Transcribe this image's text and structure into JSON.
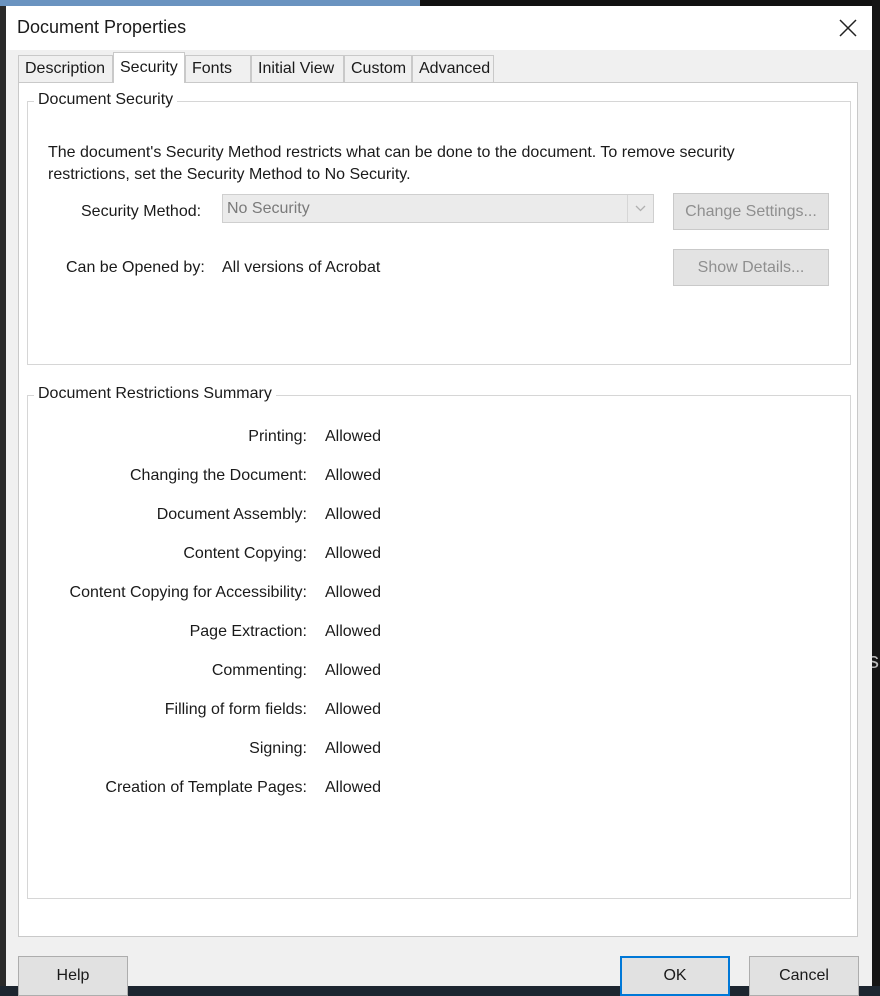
{
  "window": {
    "title": "Document Properties"
  },
  "tabs": [
    {
      "label": "Description",
      "active": false
    },
    {
      "label": "Security",
      "active": true
    },
    {
      "label": "Fonts",
      "active": false
    },
    {
      "label": "Initial View",
      "active": false
    },
    {
      "label": "Custom",
      "active": false
    },
    {
      "label": "Advanced",
      "active": false
    }
  ],
  "document_security": {
    "group_title": "Document Security",
    "description": "The document's Security Method restricts what can be done to the document. To remove security restrictions, set the Security Method to No Security.",
    "method_label": "Security Method:",
    "method_value": "No Security",
    "change_settings_label": "Change Settings...",
    "opened_by_label": "Can be Opened by:",
    "opened_by_value": "All versions of Acrobat",
    "show_details_label": "Show Details..."
  },
  "restrictions": {
    "group_title": "Document Restrictions Summary",
    "items": [
      {
        "label": "Printing:",
        "value": "Allowed"
      },
      {
        "label": "Changing the Document:",
        "value": "Allowed"
      },
      {
        "label": "Document Assembly:",
        "value": "Allowed"
      },
      {
        "label": "Content Copying:",
        "value": "Allowed"
      },
      {
        "label": "Content Copying for Accessibility:",
        "value": "Allowed"
      },
      {
        "label": "Page Extraction:",
        "value": "Allowed"
      },
      {
        "label": "Commenting:",
        "value": "Allowed"
      },
      {
        "label": "Filling of form fields:",
        "value": "Allowed"
      },
      {
        "label": "Signing:",
        "value": "Allowed"
      },
      {
        "label": "Creation of Template Pages:",
        "value": "Allowed"
      }
    ]
  },
  "buttons": {
    "help": "Help",
    "ok": "OK",
    "cancel": "Cancel"
  },
  "icons": {
    "close": "close-icon",
    "dropdown": "chevron-down-icon"
  },
  "colors": {
    "accent": "#0078d7",
    "disabled_text": "#8f8f8f"
  }
}
